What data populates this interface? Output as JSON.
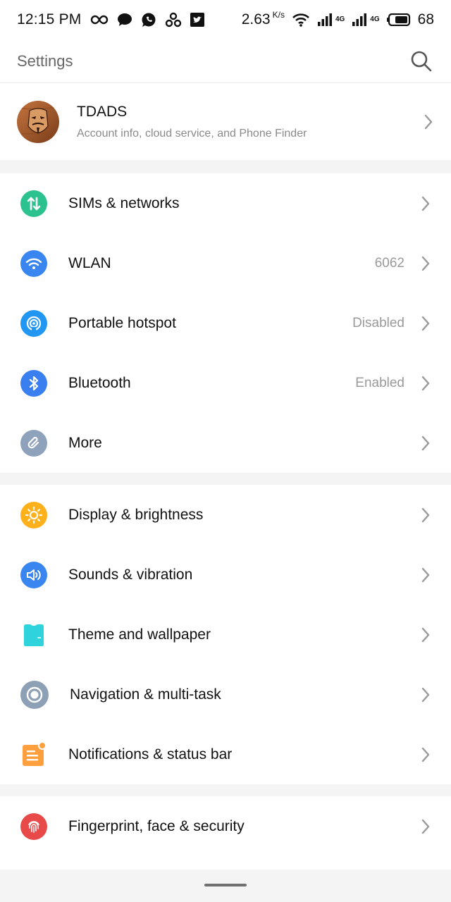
{
  "status_bar": {
    "time": "12:15 PM",
    "speed": "2.63",
    "speed_unit": "K/s",
    "battery": "68",
    "network_tag": "4G"
  },
  "app_bar": {
    "title": "Settings"
  },
  "account": {
    "name": "TDADS",
    "subtitle": "Account info, cloud service, and Phone Finder"
  },
  "groups": {
    "connectivity": [
      {
        "label": "SIMs & networks",
        "value": "",
        "icon": "sim-icon",
        "color": "#2bc28f"
      },
      {
        "label": "WLAN",
        "value": "6062",
        "icon": "wifi-icon",
        "color": "#3a86f0"
      },
      {
        "label": "Portable hotspot",
        "value": "Disabled",
        "icon": "hotspot-icon",
        "color": "#2196f3"
      },
      {
        "label": "Bluetooth",
        "value": "Enabled",
        "icon": "bluetooth-icon",
        "color": "#3a7ff0"
      },
      {
        "label": "More",
        "value": "",
        "icon": "link-icon",
        "color": "#8fa2bb"
      }
    ],
    "device": [
      {
        "label": "Display & brightness",
        "icon": "sun-icon",
        "color": "#ffb11b"
      },
      {
        "label": "Sounds & vibration",
        "icon": "speaker-icon",
        "color": "#3a86f0"
      },
      {
        "label": "Theme and wallpaper",
        "icon": "shirt-icon",
        "color": "#2fd3dc"
      },
      {
        "label": "Navigation & multi-task",
        "icon": "navigation-icon",
        "color": "#8ea0b6"
      },
      {
        "label": "Notifications & status bar",
        "icon": "notification-icon",
        "color": "#ff9f3d"
      }
    ],
    "security": [
      {
        "label": "Fingerprint, face & security",
        "icon": "fingerprint-icon",
        "color": "#e84a4a"
      }
    ]
  }
}
